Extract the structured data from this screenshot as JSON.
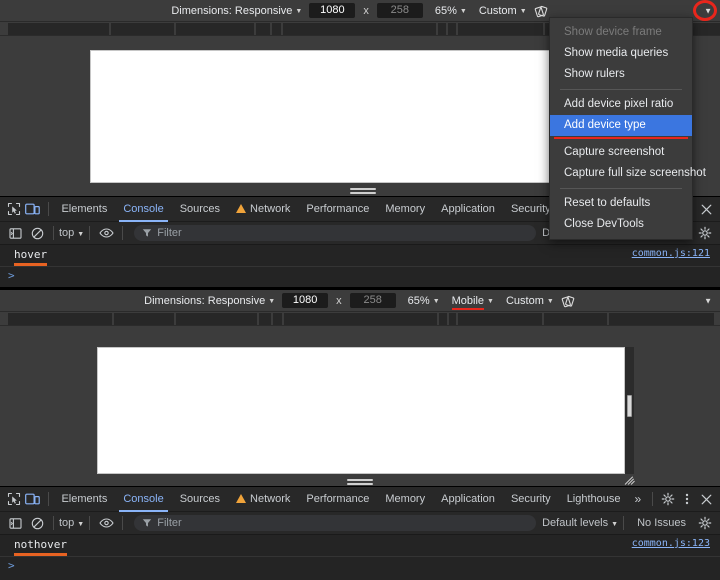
{
  "panels": [
    {
      "id": "top",
      "toolbar": {
        "dimensions_label": "Dimensions: Responsive",
        "width_value": "1080",
        "x_separator": "x",
        "height_value": "258",
        "zoom_value": "65%",
        "device_type_label": null,
        "throttling_label": "Custom",
        "rotate_icon": "rotate-icon",
        "overflow_icon": "chevron-down-icon"
      },
      "console": {
        "message": "hover",
        "source": "common.js:121",
        "prompt": ">"
      }
    },
    {
      "id": "bottom",
      "toolbar": {
        "dimensions_label": "Dimensions: Responsive",
        "width_value": "1080",
        "x_separator": "x",
        "height_value": "258",
        "zoom_value": "65%",
        "device_type_label": "Mobile",
        "throttling_label": "Custom",
        "rotate_icon": "rotate-icon",
        "overflow_icon": "chevron-down-icon"
      },
      "console": {
        "message": "nothover",
        "source": "common.js:123",
        "prompt": ">"
      }
    }
  ],
  "devtools": {
    "tabs": [
      {
        "label": "Elements",
        "active": false,
        "warning": false
      },
      {
        "label": "Console",
        "active": true,
        "warning": false
      },
      {
        "label": "Sources",
        "active": false,
        "warning": false
      },
      {
        "label": "Network",
        "active": false,
        "warning": true
      },
      {
        "label": "Performance",
        "active": false,
        "warning": false
      },
      {
        "label": "Memory",
        "active": false,
        "warning": false
      },
      {
        "label": "Application",
        "active": false,
        "warning": false
      },
      {
        "label": "Security",
        "active": false,
        "warning": false
      },
      {
        "label": "Lighthouse",
        "active": false,
        "warning": false
      }
    ],
    "more_tabs_label": "»",
    "icons": {
      "inspect": "inspect-element-icon",
      "device_toggle": "device-toolbar-icon",
      "settings": "gear-icon",
      "kebab": "more-options-icon",
      "close": "close-icon"
    },
    "filterbar": {
      "sidebar_toggle_icon": "console-sidebar-icon",
      "clear_icon": "clear-console-icon",
      "context_label": "top",
      "eye_icon": "live-expression-icon",
      "filter_icon": "filter-funnel-icon",
      "filter_placeholder": "Filter",
      "levels_label": "Default levels",
      "issues_label": "No Issues",
      "settings_icon": "gear-icon"
    }
  },
  "context_menu": {
    "items": [
      {
        "label": "Show device frame",
        "state": "disabled"
      },
      {
        "label": "Show media queries",
        "state": "normal"
      },
      {
        "label": "Show rulers",
        "state": "normal"
      },
      {
        "separator": true
      },
      {
        "label": "Add device pixel ratio",
        "state": "normal"
      },
      {
        "label": "Add device type",
        "state": "selected"
      },
      {
        "separator": true
      },
      {
        "label": "Capture screenshot",
        "state": "normal"
      },
      {
        "label": "Capture full size screenshot",
        "state": "normal"
      },
      {
        "separator": true
      },
      {
        "label": "Reset to defaults",
        "state": "normal"
      },
      {
        "label": "Close DevTools",
        "state": "normal"
      }
    ]
  },
  "annotations": {
    "highlight_color": "#e8261c",
    "selected_color": "#3b76e0",
    "accent_color": "#8ab4f8",
    "console_underline_color": "#e86322"
  },
  "rulers": {
    "top_ticks": [
      0,
      8,
      110,
      175,
      255,
      272,
      283,
      438,
      447,
      457,
      462,
      543
    ],
    "bottom_ticks": [
      0,
      8,
      113,
      175,
      258,
      272,
      283,
      438,
      447,
      457,
      462,
      543,
      608,
      715
    ]
  }
}
